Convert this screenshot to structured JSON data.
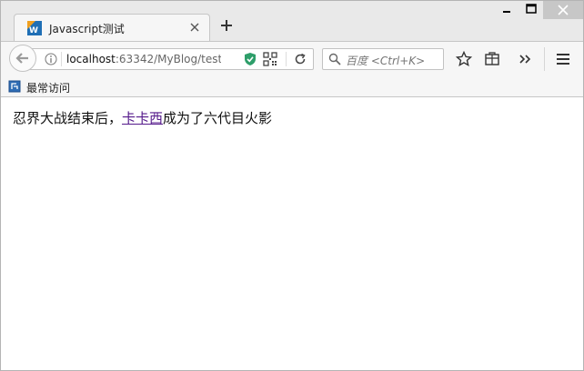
{
  "tab": {
    "title": "Javascript测试"
  },
  "urlbar": {
    "host": "localhost",
    "path": ":63342/MyBlog/test/"
  },
  "search": {
    "placeholder": "百度 <Ctrl+K>"
  },
  "bookmarks": {
    "label": "最常访问"
  },
  "content": {
    "text_before": "忍界大战结束后，",
    "link_text": "卡卡西",
    "text_after": "成为了六代目火影"
  },
  "colors": {
    "link_visited": "#551a8b",
    "shield": "#2e9e6a",
    "favicon_blue": "#1f6fb5",
    "favicon_orange": "#f0a020"
  },
  "icons": [
    "webstorm-favicon",
    "close-icon",
    "plus-icon",
    "back-arrow-icon",
    "info-icon",
    "shield-icon",
    "qr-code-icon",
    "reload-icon",
    "search-icon",
    "star-icon",
    "library-icon",
    "chevron-double-right-icon",
    "hamburger-menu-icon",
    "bookmark-folder-icon"
  ]
}
